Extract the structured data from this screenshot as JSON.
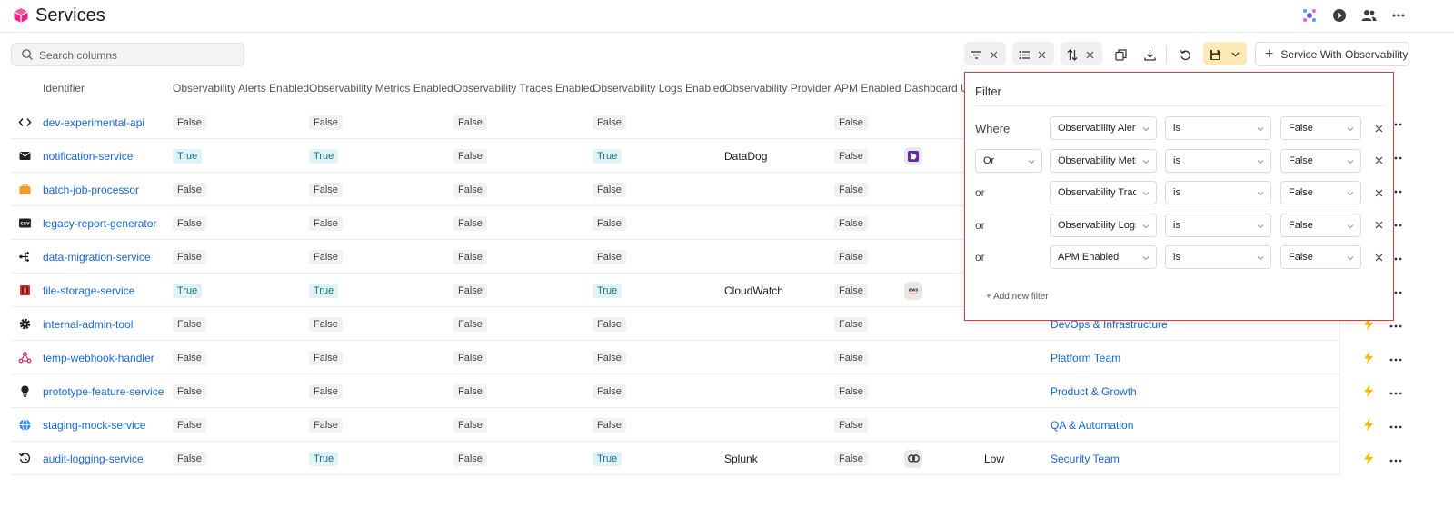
{
  "header": {
    "title": "Services"
  },
  "toolbar": {
    "search_placeholder": "Search columns",
    "add_label": "Service With Observability"
  },
  "columns": [
    "Identifier",
    "Observability Alerts Enabled",
    "Observability Metrics Enabled",
    "Observability Traces Enabled",
    "Observability Logs Enabled",
    "Observability Provider",
    "APM Enabled",
    "Dashboard UR"
  ],
  "rows": [
    {
      "id": "dev-experimental-api",
      "icon": "code-icon",
      "alerts": "False",
      "metrics": "False",
      "traces": "False",
      "logs": "False",
      "provider": "",
      "apm": "False",
      "dash": "",
      "level": "",
      "team": ""
    },
    {
      "id": "notification-service",
      "icon": "mail-icon",
      "alerts": "True",
      "metrics": "True",
      "traces": "False",
      "logs": "True",
      "provider": "DataDog",
      "apm": "False",
      "dash": "datadog-icon",
      "level": "",
      "team": ""
    },
    {
      "id": "batch-job-processor",
      "icon": "briefcase-icon",
      "alerts": "False",
      "metrics": "False",
      "traces": "False",
      "logs": "False",
      "provider": "",
      "apm": "False",
      "dash": "",
      "level": "",
      "team": ""
    },
    {
      "id": "legacy-report-generator",
      "icon": "csv-icon",
      "alerts": "False",
      "metrics": "False",
      "traces": "False",
      "logs": "False",
      "provider": "",
      "apm": "False",
      "dash": "",
      "level": "",
      "team": ""
    },
    {
      "id": "data-migration-service",
      "icon": "migration-icon",
      "alerts": "False",
      "metrics": "False",
      "traces": "False",
      "logs": "False",
      "provider": "",
      "apm": "False",
      "dash": "",
      "level": "",
      "team": ""
    },
    {
      "id": "file-storage-service",
      "icon": "storage-icon",
      "alerts": "True",
      "metrics": "True",
      "traces": "False",
      "logs": "True",
      "provider": "CloudWatch",
      "apm": "False",
      "dash": "aws-icon",
      "level": "",
      "team": ""
    },
    {
      "id": "internal-admin-tool",
      "icon": "gear-icon",
      "alerts": "False",
      "metrics": "False",
      "traces": "False",
      "logs": "False",
      "provider": "",
      "apm": "False",
      "dash": "",
      "level": "",
      "team": "DevOps & Infrastructure"
    },
    {
      "id": "temp-webhook-handler",
      "icon": "webhook-icon",
      "alerts": "False",
      "metrics": "False",
      "traces": "False",
      "logs": "False",
      "provider": "",
      "apm": "False",
      "dash": "",
      "level": "",
      "team": "Platform Team"
    },
    {
      "id": "prototype-feature-service",
      "icon": "lightbulb-icon",
      "alerts": "False",
      "metrics": "False",
      "traces": "False",
      "logs": "False",
      "provider": "",
      "apm": "False",
      "dash": "",
      "level": "",
      "team": "Product & Growth"
    },
    {
      "id": "staging-mock-service",
      "icon": "globe-icon",
      "alerts": "False",
      "metrics": "False",
      "traces": "False",
      "logs": "False",
      "provider": "",
      "apm": "False",
      "dash": "",
      "level": "",
      "team": "QA & Automation"
    },
    {
      "id": "audit-logging-service",
      "icon": "history-icon",
      "alerts": "False",
      "metrics": "True",
      "traces": "False",
      "logs": "True",
      "provider": "Splunk",
      "apm": "False",
      "dash": "link-icon",
      "level": "Low",
      "team": "Security Team"
    }
  ],
  "filter": {
    "title": "Filter",
    "rules": [
      {
        "conj": "Where",
        "conj_select": false,
        "field": "Observability Alerts Enabled",
        "op": "is",
        "value": "False"
      },
      {
        "conj": "Or",
        "conj_select": true,
        "field": "Observability Metrics Enabled",
        "op": "is",
        "value": "False"
      },
      {
        "conj": "or",
        "conj_select": false,
        "field": "Observability Traces Enabled",
        "op": "is",
        "value": "False"
      },
      {
        "conj": "or",
        "conj_select": false,
        "field": "Observability Logs Enabled",
        "op": "is",
        "value": "False"
      },
      {
        "conj": "or",
        "conj_select": false,
        "field": "APM Enabled",
        "op": "is",
        "value": "False"
      }
    ],
    "add_label": "+ Add new filter"
  },
  "colors": {
    "link": "#1767d1",
    "true_bg": "#dff3f6",
    "false_bg": "#f1f1f2",
    "save_bg": "#fde9b8",
    "bolt": "#f5b800",
    "highlight": "#e03a3a"
  }
}
